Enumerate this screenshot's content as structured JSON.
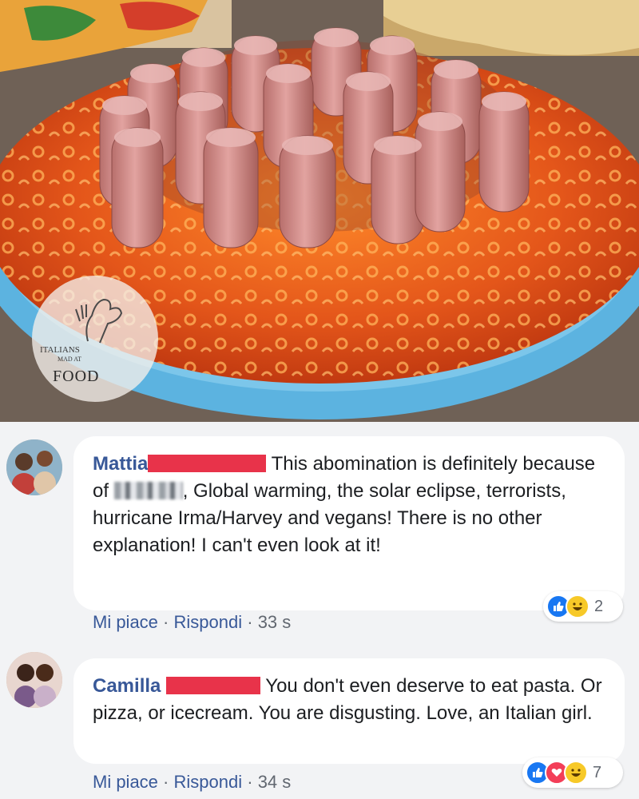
{
  "watermark": {
    "line1": "ITALIANS",
    "line2": "MAD AT",
    "line3": "FOOD"
  },
  "comments": [
    {
      "author": "Mattia",
      "text_part1": "This abomination is definitely because of",
      "text_part2": ", Global warming, the solar eclipse, terrorists, hurricane Irma/Harvey and vegans! There is no other explanation! I can't even look at it!",
      "like_label": "Mi piace",
      "reply_label": "Rispondi",
      "separator": "·",
      "time": "33 s",
      "reaction_count": "2",
      "reactions": [
        "like-icon",
        "haha-icon"
      ]
    },
    {
      "author": "Camilla",
      "text_part1": "You don't even deserve to eat pasta. Or pizza, or icecream. You are disgusting. Love, an Italian girl.",
      "like_label": "Mi piace",
      "reply_label": "Rispondi",
      "separator": "·",
      "time": "34 s",
      "reaction_count": "7",
      "reactions": [
        "like-icon",
        "love-icon",
        "haha-icon"
      ]
    }
  ],
  "colors": {
    "author": "#385898",
    "redaction": "#e8334a",
    "like": "#1877f2",
    "love": "#f33e58",
    "haha": "#f7c928"
  }
}
